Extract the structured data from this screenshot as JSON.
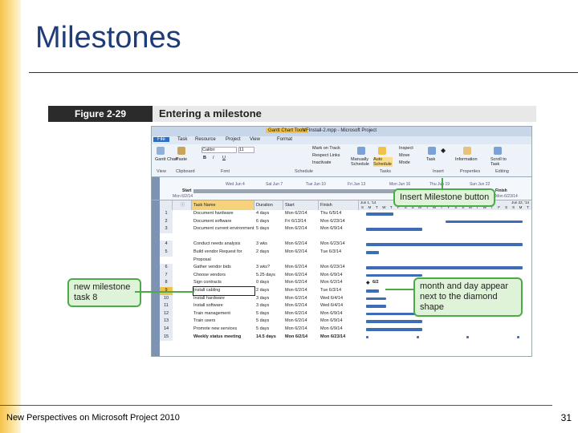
{
  "slide": {
    "title": "Milestones",
    "footer": "New Perspectives on Microsoft Project 2010",
    "page_number": "31"
  },
  "figure": {
    "label": "Figure 2-29",
    "title": "Entering a milestone"
  },
  "app": {
    "window_title": "VFInstall-2.mpp - Microsoft Project",
    "contextual_tab": "Gantt Chart Tools",
    "tabs": [
      "File",
      "Task",
      "Resource",
      "Project",
      "View",
      "Format"
    ],
    "ribbon": {
      "groups": [
        "View",
        "Clipboard",
        "Font",
        "Schedule",
        "Tasks",
        "Insert",
        "Properties",
        "Editing"
      ],
      "font_name": "Calibri",
      "font_size": "11",
      "items": {
        "gantt_chart": "Gantt Chart",
        "paste": "Paste",
        "mark_on_track": "Mark on Track",
        "respect_links": "Respect Links",
        "inactivate": "Inactivate",
        "manually_schedule": "Manually Schedule",
        "auto_schedule": "Auto Schedule",
        "inspect": "Inspect",
        "move": "Move",
        "mode": "Mode",
        "task": "Task",
        "information": "Information",
        "scroll_to_task": "Scroll to Task"
      }
    },
    "timeline": {
      "side_label": "Timeline",
      "start_label": "Start",
      "start_date": "Mon 6/2/14",
      "finish_label": "Finish",
      "finish_date": "Mon 6/23/14",
      "dates": [
        "Wed Jun 4",
        "Sat Jun 7",
        "Tue Jun 10",
        "Fri Jun 13",
        "Mon Jun 16",
        "Thu Jun 19",
        "Sun Jun 22"
      ]
    },
    "gantt": {
      "side_label": "Gantt Chart",
      "columns": [
        "Task Name",
        "Duration",
        "Start",
        "Finish"
      ],
      "weeks": [
        "Jun 1, '14",
        "Jun 8, '14",
        "Jun 15, '14",
        "Jun 22, '14"
      ],
      "days": [
        "S",
        "M",
        "T",
        "W",
        "T",
        "F",
        "S",
        "S",
        "M",
        "T",
        "W",
        "T",
        "F",
        "S",
        "S",
        "M",
        "T",
        "W",
        "T",
        "F",
        "S",
        "S",
        "M",
        "T"
      ],
      "milestone_label": "6/2",
      "rows": [
        {
          "id": "1",
          "name": "Document hardware",
          "duration": "4 days",
          "start": "Mon 6/2/14",
          "finish": "Thu 6/5/14"
        },
        {
          "id": "2",
          "name": "Document software",
          "duration": "6 days",
          "start": "Fri 6/13/14",
          "finish": "Mon 6/23/14"
        },
        {
          "id": "3",
          "name": "Document current environment",
          "duration": "5 days",
          "start": "Mon 6/2/14",
          "finish": "Mon 6/9/14"
        },
        {
          "id": "4",
          "name": "Conduct needs analysis",
          "duration": "3 wks",
          "start": "Mon 6/2/14",
          "finish": "Mon 6/23/14"
        },
        {
          "id": "5",
          "name": "Build vendor Request for Proposal",
          "duration": "2 days",
          "start": "Mon 6/2/14",
          "finish": "Tue 6/3/14"
        },
        {
          "id": "6",
          "name": "Gather vendor bids",
          "duration": "3 wks?",
          "start": "Mon 6/2/14",
          "finish": "Mon 6/23/14"
        },
        {
          "id": "7",
          "name": "Choose vendors",
          "duration": "5.25 days",
          "start": "Mon 6/2/14",
          "finish": "Mon 6/9/14"
        },
        {
          "id": "8",
          "name": "Sign contracts",
          "duration": "0 days",
          "start": "Mon 6/2/14",
          "finish": "Mon 6/2/14"
        },
        {
          "id": "9",
          "name": "Install cabling",
          "duration": "2 days",
          "start": "Mon 6/2/14",
          "finish": "Tue 6/3/14"
        },
        {
          "id": "10",
          "name": "Install hardware",
          "duration": "3 days",
          "start": "Mon 6/2/14",
          "finish": "Wed 6/4/14"
        },
        {
          "id": "11",
          "name": "Install software",
          "duration": "3 days",
          "start": "Mon 6/2/14",
          "finish": "Wed 6/4/14"
        },
        {
          "id": "12",
          "name": "Train management",
          "duration": "5 days",
          "start": "Mon 6/2/14",
          "finish": "Mon 6/9/14"
        },
        {
          "id": "13",
          "name": "Train users",
          "duration": "5 days",
          "start": "Mon 6/2/14",
          "finish": "Mon 6/9/14"
        },
        {
          "id": "14",
          "name": "Promote new services",
          "duration": "5 days",
          "start": "Mon 6/2/14",
          "finish": "Mon 6/9/14"
        },
        {
          "id": "15",
          "name": "Weekly status meeting",
          "duration": "14.5 days",
          "start": "Mon 6/2/14",
          "finish": "Mon 6/23/14"
        }
      ]
    }
  },
  "callouts": {
    "insert_milestone": "Insert Milestone button",
    "new_milestone": "new milestone task 8",
    "month_day": "month and day appear next to the diamond shape"
  },
  "colors": {
    "title": "#1f3c7a",
    "callout_border": "#4daa49",
    "callout_fill": "#dff3d8",
    "gantt_bar": "#3f6db5",
    "selected": "#f0c24b"
  }
}
